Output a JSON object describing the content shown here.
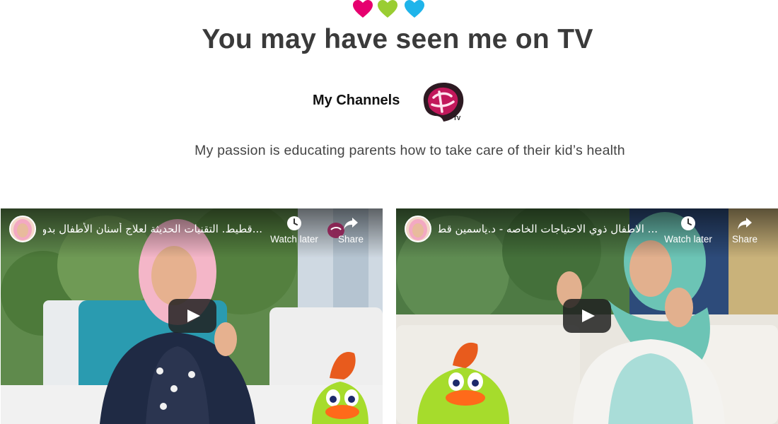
{
  "hearts": [
    {
      "icon": "heart-icon",
      "color": "#e6006f"
    },
    {
      "icon": "heart-icon",
      "color": "#9acd32"
    },
    {
      "icon": "heart-icon",
      "color": "#1fb4ea"
    }
  ],
  "header": {
    "title": "You may have seen me on TV",
    "channels_label": "My Channels",
    "channel_logo_icon": "abu-dhabi-tv-logo",
    "subtitle": "My passion is educating parents how to take care of their kid’s health"
  },
  "videos": [
    {
      "title": "...قطيط. التقنيات الحديثة لعلاج أسنان الأطفال بدون ألم",
      "watch_later_label": "Watch later",
      "share_label": "Share",
      "play_icon": "play-icon"
    },
    {
      "title": "... الاطفال ذوي الاحتياجات الخاصه - د.ياسمين قطيط",
      "watch_later_label": "Watch later",
      "share_label": "Share",
      "play_icon": "play-icon"
    }
  ],
  "colors": {
    "title": "#3a3a3a",
    "logo": "#8b1c4f",
    "play_button": "#212121"
  }
}
